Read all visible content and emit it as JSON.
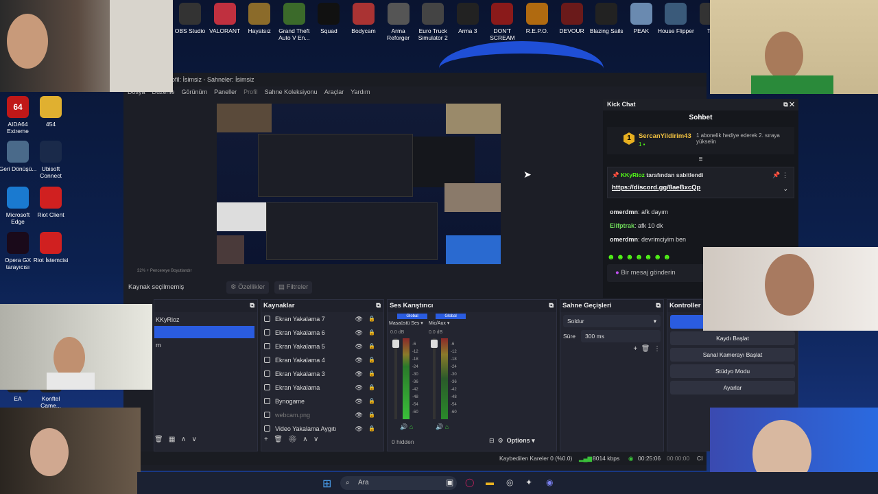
{
  "desktop": {
    "top_icons": [
      {
        "label": "OBS Studio",
        "color": "#333"
      },
      {
        "label": "VALORANT",
        "color": "#c0303f"
      },
      {
        "label": "Hayatsız",
        "color": "#8b6b2a"
      },
      {
        "label": "Grand Theft Auto V En...",
        "color": "#3b6a2a"
      },
      {
        "label": "Squad",
        "color": "#111"
      },
      {
        "label": "Bodycam",
        "color": "#a33"
      },
      {
        "label": "Arma Reforger",
        "color": "#555"
      },
      {
        "label": "Euro Truck Simulator 2",
        "color": "#444"
      },
      {
        "label": "Arma 3",
        "color": "#222"
      },
      {
        "label": "DON'T SCREAM",
        "color": "#8a1a1a"
      },
      {
        "label": "R.E.P.O.",
        "color": "#b06a10"
      },
      {
        "label": "DEVOUR",
        "color": "#6a1a1a"
      },
      {
        "label": "Blazing Sails",
        "color": "#222"
      },
      {
        "label": "PEAK",
        "color": "#6a8ab0"
      },
      {
        "label": "House Flipper",
        "color": "#3a5a7a"
      },
      {
        "label": "TL",
        "color": "#333"
      }
    ],
    "left_icons": [
      {
        "label": "AIDA64 Extreme",
        "color": "#c01818",
        "text": "64"
      },
      {
        "label": "454",
        "color": "#e0b030",
        "text": ""
      },
      {
        "label": "Geri Dönüşü...",
        "color": "#4a6a8a",
        "text": ""
      },
      {
        "label": "Ubisoft Connect",
        "color": "#1a2a4a",
        "text": ""
      },
      {
        "label": "Microsoft Edge",
        "color": "#1a7ad0",
        "text": ""
      },
      {
        "label": "Riot Client",
        "color": "#d02020",
        "text": ""
      },
      {
        "label": "Opera GX tarayıcısı",
        "color": "#1a0a1a",
        "text": ""
      },
      {
        "label": "Riot İstemcisi",
        "color": "#d02020",
        "text": ""
      },
      {
        "label": "EA",
        "color": "#222",
        "text": ""
      },
      {
        "label": "Konftel Came...",
        "color": "#222",
        "text": ""
      }
    ]
  },
  "obs": {
    "title": "ofil: İsimsiz - Sahneler: İsimsiz",
    "menu": [
      "Dosya",
      "Düzenle",
      "Görünüm",
      "Paneller",
      "Profil",
      "Sahne Koleksiyonu",
      "Araçlar",
      "Yardım"
    ],
    "preview_bar": "32%   +   Pencereye Boyutlandır",
    "no_source": "Kaynak seçilmemiş",
    "properties": "Özellikler",
    "filters": "Filtreler",
    "scenes_item": "KKyRioz",
    "scenes_item2": "m",
    "sources_title": "Kaynaklar",
    "sources": [
      "Ekran Yakalama 7",
      "Ekran Yakalama 6",
      "Ekran Yakalama 5",
      "Ekran Yakalama 4",
      "Ekran Yakalama 3",
      "Ekran Yakalama",
      "Bynogame",
      "webcam.png",
      "Video Yakalama Aygıtı"
    ],
    "mixer_title": "Ses Karıştırıcı",
    "mixer": {
      "ch1": "Masaüstü Ses",
      "ch2": "Mic/Aux",
      "global": "Global",
      "db1": "0.0 dB",
      "db2": "0.0 dB",
      "ticks": [
        "-6",
        "-12",
        "-18",
        "-24",
        "-30",
        "-36",
        "-42",
        "-48",
        "-54",
        "-60"
      ],
      "hidden": "0 hidden",
      "options": "Options"
    },
    "transitions_title": "Sahne Geçişleri",
    "transition": "Soldur",
    "duration_label": "Süre",
    "duration": "300 ms",
    "controls_title": "Kontroller",
    "controls": [
      "Kaydı Başlat",
      "Sanal Kamerayı Başlat",
      "Stüdyo Modu",
      "Ayarlar"
    ],
    "status": {
      "dropped": "Kaybedilen Kareler 0 (%0.0)",
      "kbps": "8014 kbps",
      "live": "00:25:06",
      "rec": "00:00:00",
      "cpu": "CI"
    }
  },
  "chat": {
    "title": "Kick Chat",
    "tab": "Sohbet",
    "top_user": "SercanYildirim43",
    "top_badge": "1",
    "top_gift": "1 abonelik hediye ederek 2. sıraya yükselin",
    "pinned_by": "KKyRioz",
    "pinned_suffix": "tarafından sabitlendi",
    "pinned_link": "https://discord.gg/8aeBxcQp",
    "messages": [
      {
        "user": "omerdmn",
        "color": "#e8e8e8",
        "text": "afk dayım"
      },
      {
        "user": "Elifptrak",
        "color": "#6fdc5a",
        "text": "afk 10 dk"
      },
      {
        "user": "omerdmn",
        "color": "#e8e8e8",
        "text": "devrimciyim ben"
      }
    ],
    "input_placeholder": "Bir mesaj gönderin"
  },
  "taskbar": {
    "search": "Ara"
  },
  "colors": {
    "accent": "#2a5ce0",
    "kick_green": "#53fc18",
    "obs_bg": "#1c1e26"
  }
}
